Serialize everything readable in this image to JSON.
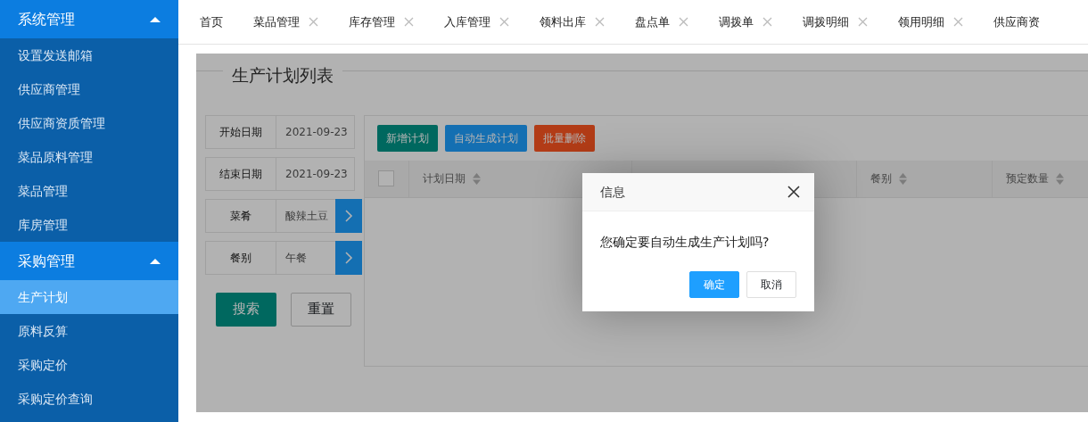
{
  "sidebar": {
    "groups": [
      {
        "title": "系统管理",
        "expanded": true,
        "items": [
          {
            "label": "设置发送邮箱",
            "selected": false
          },
          {
            "label": "供应商管理",
            "selected": false
          },
          {
            "label": "供应商资质管理",
            "selected": false
          },
          {
            "label": "菜品原料管理",
            "selected": false
          },
          {
            "label": "菜品管理",
            "selected": false
          },
          {
            "label": "库房管理",
            "selected": false
          }
        ]
      },
      {
        "title": "采购管理",
        "expanded": true,
        "items": [
          {
            "label": "生产计划",
            "selected": true
          },
          {
            "label": "原料反算",
            "selected": false
          },
          {
            "label": "采购定价",
            "selected": false
          },
          {
            "label": "采购定价查询",
            "selected": false
          }
        ]
      }
    ]
  },
  "tabs": [
    {
      "label": "首页",
      "closable": false
    },
    {
      "label": "菜品管理",
      "closable": true
    },
    {
      "label": "库存管理",
      "closable": true
    },
    {
      "label": "入库管理",
      "closable": true
    },
    {
      "label": "领料出库",
      "closable": true
    },
    {
      "label": "盘点单",
      "closable": true
    },
    {
      "label": "调拨单",
      "closable": true
    },
    {
      "label": "调拨明细",
      "closable": true
    },
    {
      "label": "领用明细",
      "closable": true
    },
    {
      "label": "供应商资",
      "closable": false
    }
  ],
  "page_title": "生产计划列表",
  "filters": [
    {
      "label": "开始日期",
      "value": "2021-09-23",
      "kind": "date"
    },
    {
      "label": "结束日期",
      "value": "2021-09-23",
      "kind": "date"
    },
    {
      "label": "菜肴",
      "value": "酸辣土豆",
      "kind": "select"
    },
    {
      "label": "餐别",
      "value": "午餐",
      "kind": "select"
    }
  ],
  "search_buttons": [
    "搜索",
    "重置"
  ],
  "toolbar": [
    {
      "label": "新增计划",
      "kind": "add"
    },
    {
      "label": "自动生成计划",
      "kind": "normal"
    },
    {
      "label": "批量删除",
      "kind": "danger"
    }
  ],
  "table": {
    "select_all_checked": false,
    "columns": [
      "计划日期",
      "",
      "餐别",
      "预定数量"
    ]
  },
  "dialog": {
    "title": "信息",
    "message": "您确定要自动生成生产计划吗?",
    "buttons": [
      {
        "label": "确定",
        "primary": true
      },
      {
        "label": "取消",
        "primary": false
      }
    ]
  }
}
